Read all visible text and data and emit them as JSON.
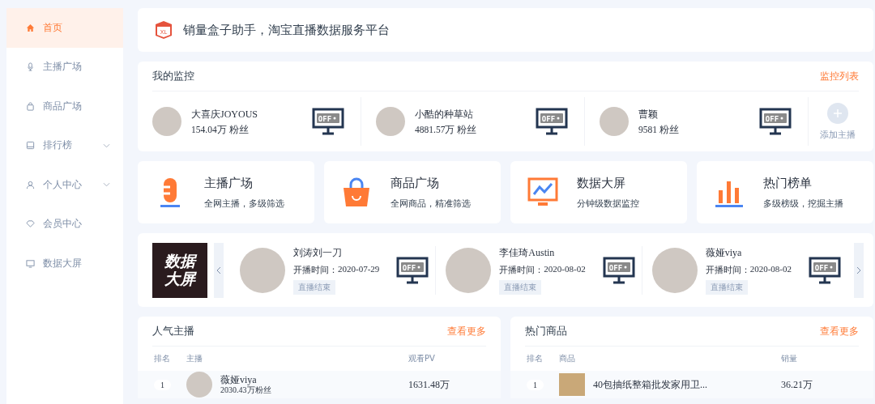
{
  "sidebar": {
    "items": [
      {
        "label": "首页",
        "selected": true,
        "expandable": false
      },
      {
        "label": "主播广场",
        "selected": false,
        "expandable": false
      },
      {
        "label": "商品广场",
        "selected": false,
        "expandable": false
      },
      {
        "label": "排行榜",
        "selected": false,
        "expandable": true
      },
      {
        "label": "个人中心",
        "selected": false,
        "expandable": true
      },
      {
        "label": "会员中心",
        "selected": false,
        "expandable": false
      },
      {
        "label": "数据大屏",
        "selected": false,
        "expandable": false
      }
    ]
  },
  "header": {
    "logo_text": "XL",
    "title": "销量盒子助手，淘宝直播数据服务平台"
  },
  "monitor": {
    "title": "我的监控",
    "link": "监控列表",
    "add_label": "添加主播",
    "streamers": [
      {
        "name": "大喜庆JOYOUS",
        "fans": "154.04万 粉丝",
        "screen_label": "OFF"
      },
      {
        "name": "小酷的种草站",
        "fans": "4881.57万 粉丝",
        "screen_label": "OFF"
      },
      {
        "name": "曹颖",
        "fans": "9581 粉丝",
        "screen_label": "OFF"
      }
    ]
  },
  "features": [
    {
      "title": "主播广场",
      "subtitle": "全网主播，多级筛选"
    },
    {
      "title": "商品广场",
      "subtitle": "全网商品，精准筛选"
    },
    {
      "title": "数据大屏",
      "subtitle": "分钟级数据监控"
    },
    {
      "title": "热门榜单",
      "subtitle": "多级榜级，挖掘主播"
    }
  ],
  "live_carousel": {
    "banner_lines": [
      "数据",
      "大屏"
    ],
    "items": [
      {
        "name": "刘涛刘一刀",
        "time_label": "开播时间：",
        "date": "2020-07-29",
        "status": "直播结束",
        "screen_label": "OFF"
      },
      {
        "name": "李佳琦Austin",
        "time_label": "开播时间：",
        "date": "2020-08-02",
        "status": "直播结束",
        "screen_label": "OFF"
      },
      {
        "name": "薇娅viya",
        "time_label": "开播时间：",
        "date": "2020-08-02",
        "status": "直播结束",
        "screen_label": "OFF"
      }
    ]
  },
  "popular_streamers": {
    "title": "人气主播",
    "link": "查看更多",
    "columns": [
      "排名",
      "主播",
      "观看PV"
    ],
    "rows": [
      {
        "rank": "1",
        "name": "薇娅viya",
        "fans": "2030.43万粉丝",
        "pv": "1631.48万"
      }
    ]
  },
  "hot_products": {
    "title": "热门商品",
    "link": "查看更多",
    "columns": [
      "排名",
      "商品",
      "销量"
    ],
    "rows": [
      {
        "rank": "1",
        "name": "40包抽纸整箱批发家用卫...",
        "sales": "36.21万"
      }
    ]
  }
}
